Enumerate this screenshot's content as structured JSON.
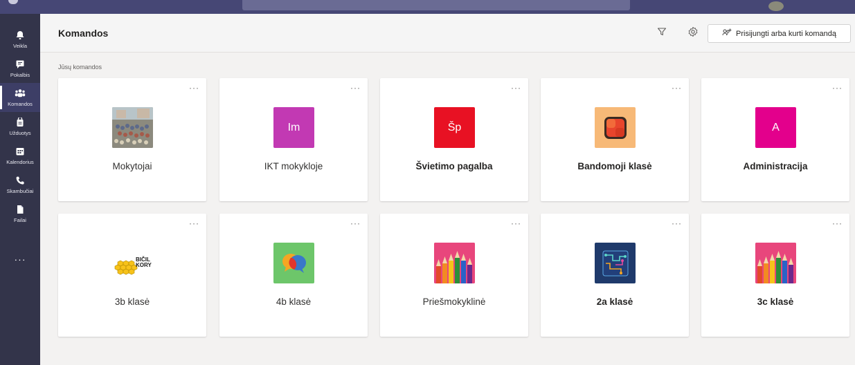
{
  "header": {
    "title": "Komandos",
    "join_label": "Prisijungti arba kurti komandą"
  },
  "rail": [
    {
      "label": "Veikla",
      "icon": "bell-icon"
    },
    {
      "label": "Pokalbis",
      "icon": "chat-icon"
    },
    {
      "label": "Komandos",
      "icon": "teams-icon",
      "active": true
    },
    {
      "label": "Užduotys",
      "icon": "assignments-icon"
    },
    {
      "label": "Kalendorius",
      "icon": "calendar-icon"
    },
    {
      "label": "Skambučiai",
      "icon": "phone-icon"
    },
    {
      "label": "Failai",
      "icon": "files-icon"
    }
  ],
  "rail_more": "···",
  "section_label": "Jūsų komandos",
  "more_glyph": "···",
  "teams": [
    {
      "name": "Mokytojai",
      "tile_type": "photo",
      "bold": false
    },
    {
      "name": "IKT mokykloje",
      "tile_text": "Im",
      "tile_color": "#c239b3",
      "bold": false
    },
    {
      "name": "Švietimo pagalba",
      "tile_text": "Šp",
      "tile_color": "#e81123",
      "bold": true
    },
    {
      "name": "Bandomoji klasė",
      "tile_type": "orange-square",
      "tile_color": "#f7b977",
      "bold": true
    },
    {
      "name": "Administracija",
      "tile_text": "A",
      "tile_color": "#e3008c",
      "bold": true
    },
    {
      "name": "3b klasė",
      "tile_type": "bees",
      "tile_text": "BIČIL KORY",
      "bold": false
    },
    {
      "name": "4b klasė",
      "tile_type": "chat-bubbles",
      "tile_color": "#6dc66a",
      "bold": false
    },
    {
      "name": "Priešmokyklinė",
      "tile_type": "pencils",
      "tile_color": "#e8467c",
      "bold": false
    },
    {
      "name": "2a klasė",
      "tile_type": "circuit",
      "tile_color": "#1f3a6b",
      "bold": true
    },
    {
      "name": "3c klasė",
      "tile_type": "pencils",
      "tile_color": "#e8467c",
      "bold": true
    }
  ]
}
